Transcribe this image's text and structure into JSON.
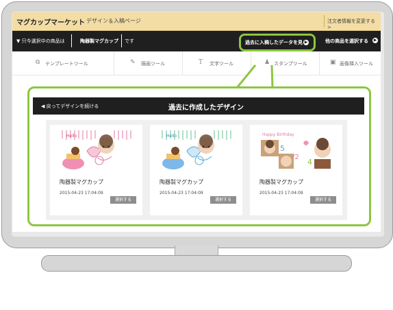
{
  "header": {
    "brand": "マグカップマーケット",
    "subtitle": "デザイン＆入稿ページ",
    "link": "注文者情報を変更する >"
  },
  "bar": {
    "selected_prefix": "▼ 只今選択中の商品は",
    "product_label": "陶器製マグカップ",
    "suffix": "です",
    "past_button": "過去に入稿したデータを見る",
    "other_button": "他の商品を選択する"
  },
  "tools": [
    {
      "icon": "template-icon",
      "label": "テンプレートツール"
    },
    {
      "icon": "pencil-icon",
      "label": "描画ツール"
    },
    {
      "icon": "text-icon",
      "label": "文字ツール"
    },
    {
      "icon": "stamp-icon",
      "label": "スタンプツール"
    },
    {
      "icon": "image-icon",
      "label": "画像挿入ツール"
    }
  ],
  "panel": {
    "back": "戻ってデザインを続ける",
    "title": "過去に作成したデザイン"
  },
  "designs": [
    {
      "name": "陶器製マグカップ",
      "date": "2015-04-23 17:04:09",
      "button": "選択する",
      "thumb_text": "Hello"
    },
    {
      "name": "陶器製マグカップ",
      "date": "2015-04-23 17:04:09",
      "button": "選択する",
      "thumb_text": "Hello"
    },
    {
      "name": "陶器製マグカップ",
      "date": "2015-04-23 17:04:09",
      "button": "選択する",
      "thumb_text": "Happy Birthday"
    }
  ],
  "colors": {
    "accent": "#8cc63f",
    "topbar": "#f3dda4",
    "dark": "#1f1f1f"
  }
}
